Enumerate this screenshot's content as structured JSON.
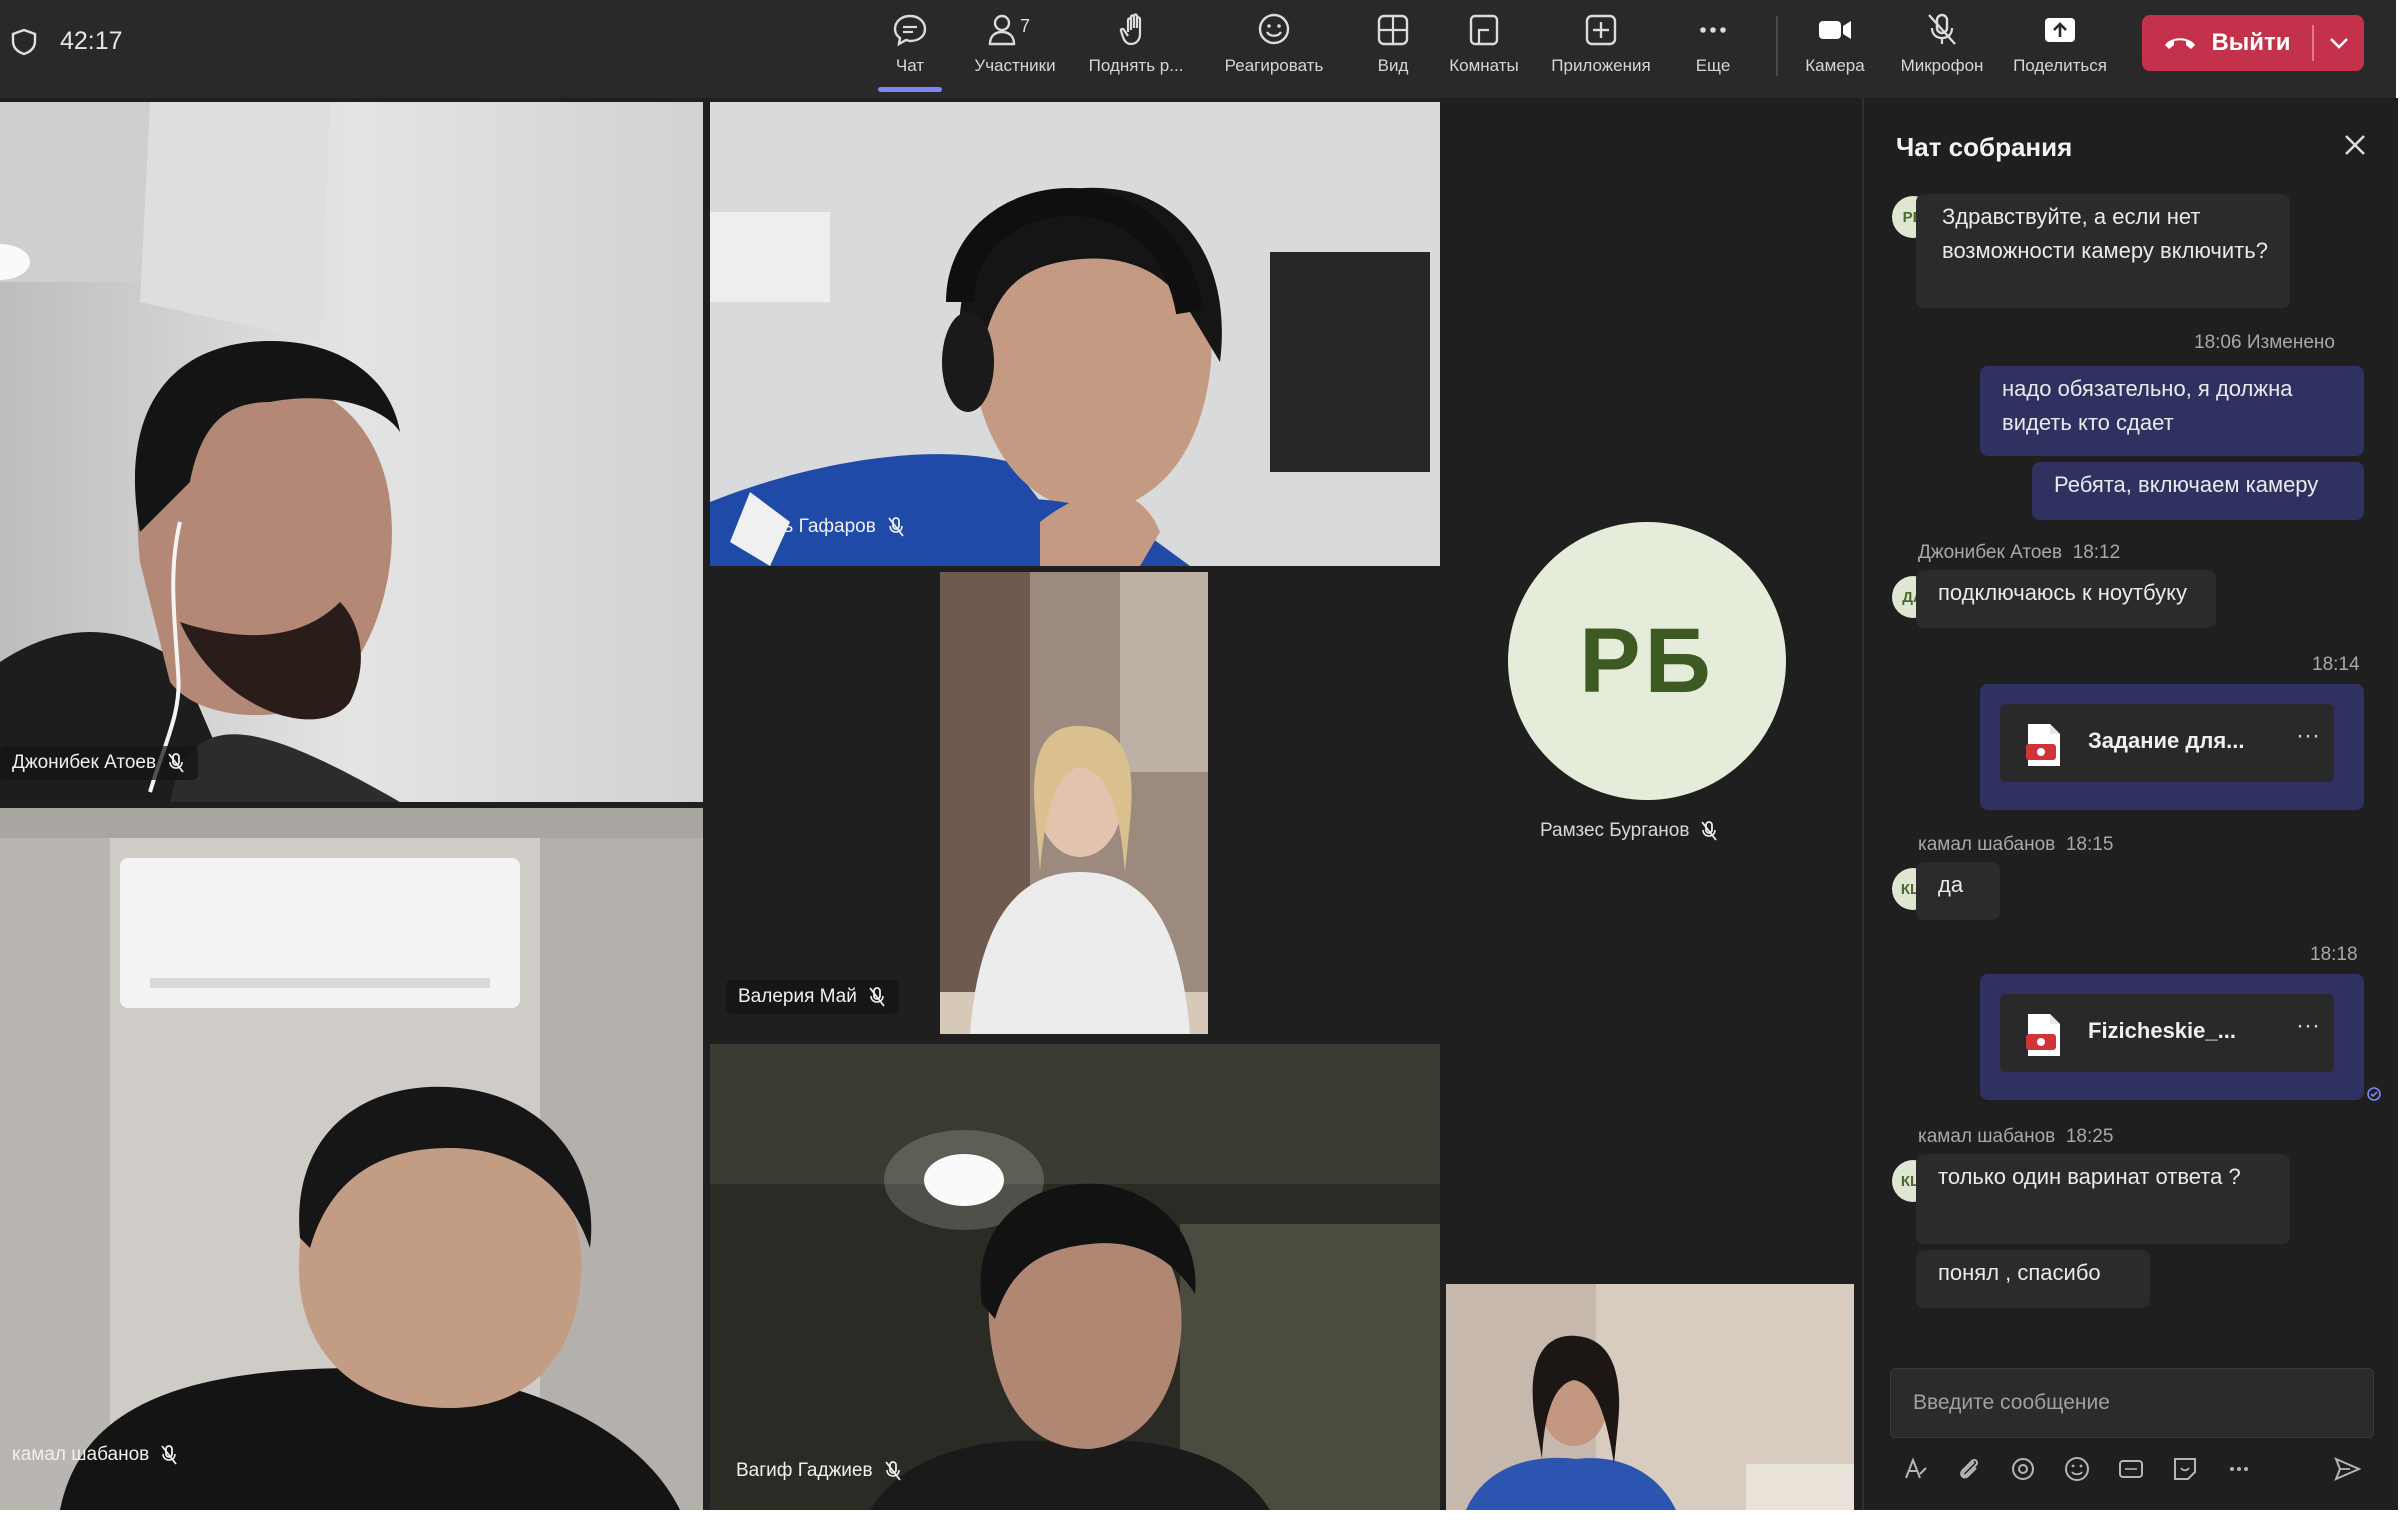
{
  "meeting": {
    "timer": "42:17"
  },
  "toolbar": {
    "items": [
      {
        "id": "chat",
        "label": "Чат",
        "icon": "chat-icon"
      },
      {
        "id": "people",
        "label": "Участники",
        "icon": "people-icon",
        "count": "7"
      },
      {
        "id": "raise",
        "label": "Поднять р...",
        "icon": "hand-icon"
      },
      {
        "id": "react",
        "label": "Реагировать",
        "icon": "smile-icon"
      },
      {
        "id": "view",
        "label": "Вид",
        "icon": "grid-icon"
      },
      {
        "id": "rooms",
        "label": "Комнаты",
        "icon": "rooms-icon"
      },
      {
        "id": "apps",
        "label": "Приложения",
        "icon": "plus-icon"
      },
      {
        "id": "more",
        "label": "Еще",
        "icon": "more-icon"
      },
      {
        "id": "camera",
        "label": "Камера",
        "icon": "camera-icon"
      },
      {
        "id": "mic",
        "label": "Микрофон",
        "icon": "mic-off-icon"
      },
      {
        "id": "share",
        "label": "Поделиться",
        "icon": "share-icon"
      }
    ],
    "leave_label": "Выйти",
    "leave_color": "#c4314b",
    "accent": "#7f85f5"
  },
  "participants": [
    {
      "name": "Джонибек Атоев",
      "muted": true
    },
    {
      "name": "Амиль Гафаров",
      "muted": true
    },
    {
      "name": "Валерия Май",
      "muted": true
    },
    {
      "name": "Рамзес Бурганов",
      "muted": true,
      "initials": "РБ"
    },
    {
      "name": "камал шабанов",
      "muted": true
    },
    {
      "name": "Вагиф Гаджиев",
      "muted": true
    }
  ],
  "chat": {
    "title": "Чат собрания",
    "messages": [
      {
        "initials": "РБ",
        "text": "Здравствуйте, а если нет возможности камеру включить?"
      },
      {
        "meta": "18:06  Изменено",
        "text": "надо обязательно, я должна видеть кто сдает"
      },
      {
        "text": "Ребята, включаем камеру"
      },
      {
        "author": "Джонибек Атоев",
        "time": "18:12",
        "initials": "ДА",
        "text": "подключаюсь к ноутбуку"
      },
      {
        "time": "18:14",
        "file": "Задание для..."
      },
      {
        "author": "камал шабанов",
        "time": "18:15",
        "initials": "КШ",
        "text": "да"
      },
      {
        "time": "18:18",
        "file": "Fizicheskie_..."
      },
      {
        "author": "камал шабанов",
        "time": "18:25",
        "initials": "КШ",
        "text": "только один варинат ответа ?"
      },
      {
        "text": "понял , спасибо"
      }
    ],
    "input_placeholder": "Введите сообщение"
  }
}
